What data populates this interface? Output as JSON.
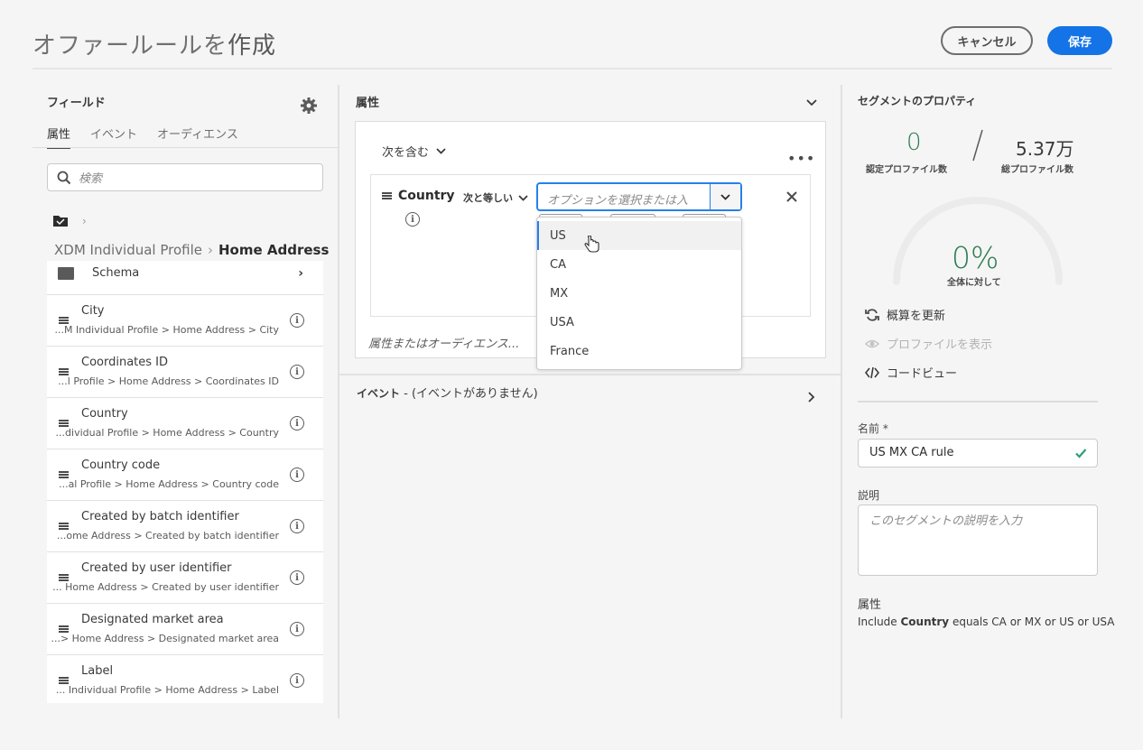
{
  "header": {
    "title_prefix": "オファールールを",
    "title_strong": "作成",
    "cancel_label": "キャンセル",
    "save_label": "保存"
  },
  "left_panel": {
    "title": "フィールド",
    "tabs": [
      {
        "label": "属性",
        "active": true
      },
      {
        "label": "イベント",
        "active": false
      },
      {
        "label": "オーディエンス",
        "active": false
      }
    ],
    "search_placeholder": "検索",
    "path_root": "XDM Individual Profile",
    "path_current": "Home Address",
    "schema_label": "Schema",
    "fields": [
      {
        "name": "City",
        "path": "...M Individual Profile > Home Address > City"
      },
      {
        "name": "Coordinates ID",
        "path": "...l Profile > Home Address > Coordinates ID"
      },
      {
        "name": "Country",
        "path": "...dividual Profile > Home Address > Country"
      },
      {
        "name": "Country code",
        "path": "...al Profile > Home Address > Country code"
      },
      {
        "name": "Created by batch identifier",
        "path": "...ome Address > Created by batch identifier"
      },
      {
        "name": "Created by user identifier",
        "path": "... Home Address > Created by user identifier"
      },
      {
        "name": "Designated market area",
        "path": "...> Home Address > Designated market area"
      },
      {
        "name": "Label",
        "path": "... Individual Profile > Home Address > Label"
      }
    ]
  },
  "middle_panel": {
    "title": "属性",
    "contains_label": "次を含む",
    "condition": {
      "field": "Country",
      "operator": "次と等しい",
      "placeholder": "オプションを選択または入"
    },
    "dropdown_options": [
      "US",
      "CA",
      "MX",
      "USA",
      "France"
    ],
    "highlighted_option": "US",
    "drop_hint": "属性またはオーディエンス...",
    "events_title": "イベント",
    "events_note": " - (イベントがありません)"
  },
  "right_panel": {
    "title": "セグメントのプロパティ",
    "qualified_value": "0",
    "qualified_label": "認定プロファイル数",
    "total_value": "5.37万",
    "total_label": "総プロファイル数",
    "percent_value": "0%",
    "percent_label": "全体に対して",
    "gauge_fraction": 0,
    "refresh_label": "概算を更新",
    "view_profiles_label": "プロファイルを表示",
    "code_view_label": "コードビュー",
    "name_label": "名前 *",
    "name_value": "US MX CA rule",
    "description_label": "説明",
    "description_placeholder": "このセグメントの説明を入力",
    "attributes_label": "属性",
    "summary_prefix": "Include ",
    "summary_field": "Country",
    "summary_suffix": " equals CA or MX or US or USA"
  },
  "colors": {
    "accent": "#1473e6",
    "success": "#2d7d4f"
  }
}
